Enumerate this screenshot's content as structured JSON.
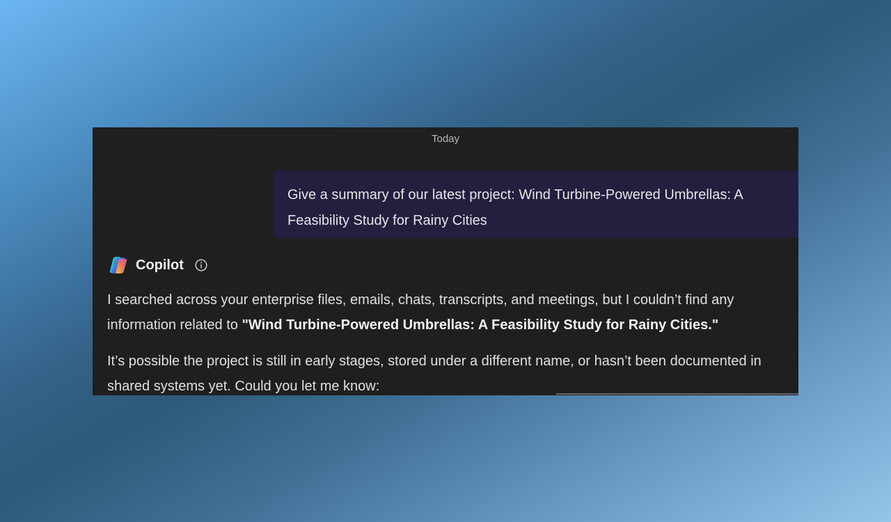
{
  "chat": {
    "date_divider": "Today",
    "user_message": "Give a summary of our latest project: Wind Turbine-Powered Umbrellas: A Feasibility Study for Rainy Cities",
    "assistant": {
      "name": "Copilot",
      "logo_icon": "copilot-logo-icon",
      "info_icon": "info-icon",
      "paragraph1_text": "I searched across your enterprise files, emails, chats, transcripts, and meetings, but I couldn’t find any information related to ",
      "paragraph1_bold": "\"Wind Turbine-Powered Umbrellas: A Feasibility Study for Rainy Cities.\"",
      "paragraph2": "It’s possible the project is still in early stages, stored under a different name, or hasn’t been documented in shared systems yet. Could you let me know:"
    }
  },
  "colors": {
    "window_bg": "#1f1f1f",
    "user_bubble_bg": "#221f3f",
    "text": "#e0e0e0",
    "muted_text": "#b8b8b8"
  }
}
